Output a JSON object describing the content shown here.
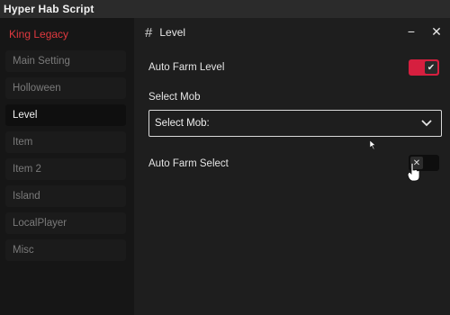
{
  "window": {
    "title": "Hyper Hab Script"
  },
  "sidebar": {
    "brand": "King Legacy",
    "items": [
      {
        "label": "Main Setting",
        "active": false
      },
      {
        "label": "Holloween",
        "active": false
      },
      {
        "label": "Level",
        "active": true
      },
      {
        "label": "Item",
        "active": false
      },
      {
        "label": "Item 2",
        "active": false
      },
      {
        "label": "Island",
        "active": false
      },
      {
        "label": "LocalPlayer",
        "active": false
      },
      {
        "label": "Misc",
        "active": false
      }
    ]
  },
  "page": {
    "title": "Level",
    "icon": "hash-icon",
    "controls": {
      "minimize": "−",
      "close": "✕"
    }
  },
  "settings": {
    "auto_farm_level": {
      "label": "Auto Farm Level",
      "enabled": true,
      "icon": "check-icon"
    },
    "select_mob": {
      "label": "Select Mob",
      "value": "Select Mob:",
      "icon": "chevron-down-icon"
    },
    "auto_farm_select": {
      "label": "Auto Farm Select",
      "enabled": false,
      "icon": "x-icon"
    }
  },
  "colors": {
    "accent": "#d61f3f",
    "brand": "#e0393f",
    "sidebar_bg": "#161616",
    "content_bg": "#1e1e1e"
  }
}
